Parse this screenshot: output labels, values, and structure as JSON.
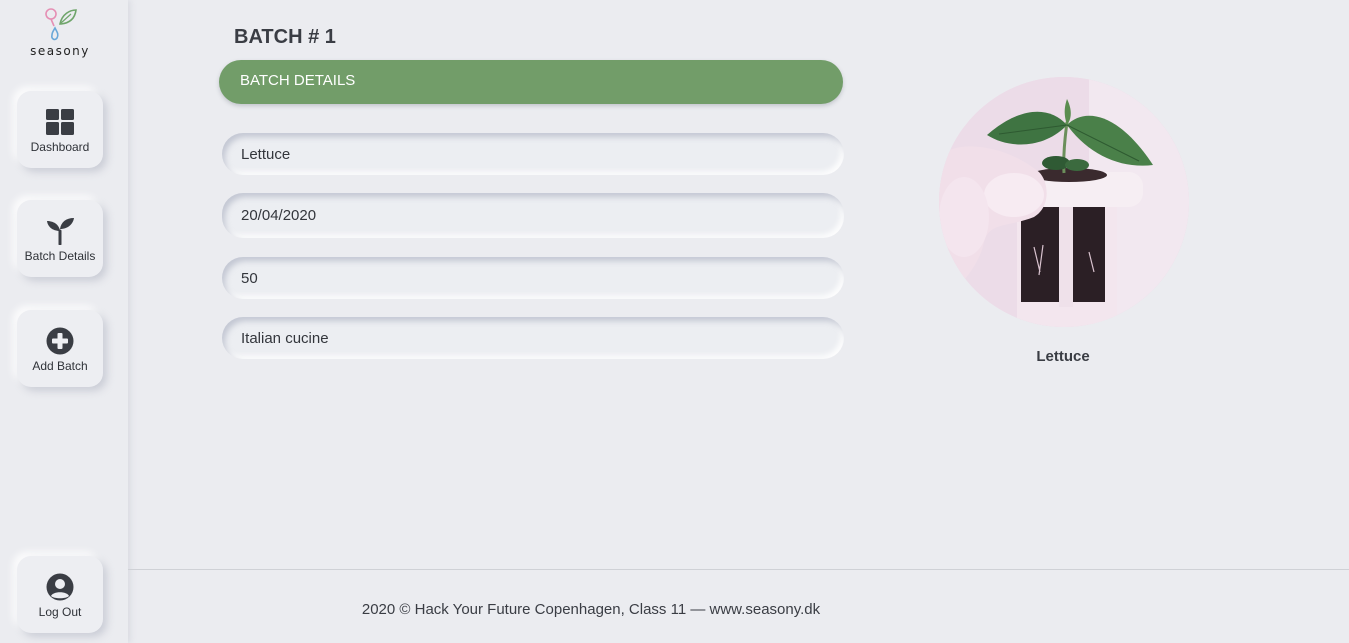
{
  "brand": {
    "name": "seasony"
  },
  "sidebar": {
    "items": [
      {
        "label": "Dashboard",
        "icon": "dashboard-icon"
      },
      {
        "label": "Batch Details",
        "icon": "sprout-icon"
      },
      {
        "label": "Add Batch",
        "icon": "plus-circle-icon"
      }
    ],
    "logout": {
      "label": "Log Out",
      "icon": "user-circle-icon"
    }
  },
  "main": {
    "title": "BATCH # 1",
    "section_label": "BATCH DETAILS",
    "fields": {
      "crop": "Lettuce",
      "date": "20/04/2020",
      "quantity": "50",
      "usage": "Italian cucine"
    },
    "photo_caption": "Lettuce"
  },
  "footer": {
    "text": "2020 © Hack Your Future Copenhagen, Class 11 — www.seasony.dk"
  },
  "colors": {
    "accent": "#729d69",
    "background": "#ebecf0",
    "text": "#3a3d44"
  }
}
